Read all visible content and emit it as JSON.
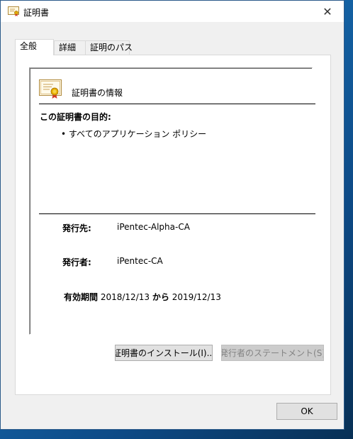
{
  "window": {
    "title": "証明書",
    "close_glyph": "✕"
  },
  "tabs": [
    {
      "label": "全般",
      "active": true
    },
    {
      "label": "詳細",
      "active": false
    },
    {
      "label": "証明のパス",
      "active": false
    }
  ],
  "general": {
    "info_title": "証明書の情報",
    "purpose_heading": "この証明書の目的:",
    "purpose_items": [
      "• すべてのアプリケーション ポリシー"
    ],
    "issued_to_label": "発行先:",
    "issued_to_value": "iPentec-Alpha-CA",
    "issued_by_label": "発行者:",
    "issued_by_value": "iPentec-CA",
    "validity_label": "有効期間",
    "valid_from": "2018/12/13",
    "validity_connector": "から",
    "valid_to": "2019/12/13"
  },
  "buttons": {
    "install": "証明書のインストール(I)...",
    "issuer_statement": "発行者のステートメント(S)",
    "ok": "OK"
  },
  "icons": {
    "title_icon": "certificate-icon",
    "info_icon": "certificate-icon",
    "close_icon": "close-icon"
  },
  "colors": {
    "accent_ribbon": "#d4a017",
    "desktop": "#1565a8"
  }
}
